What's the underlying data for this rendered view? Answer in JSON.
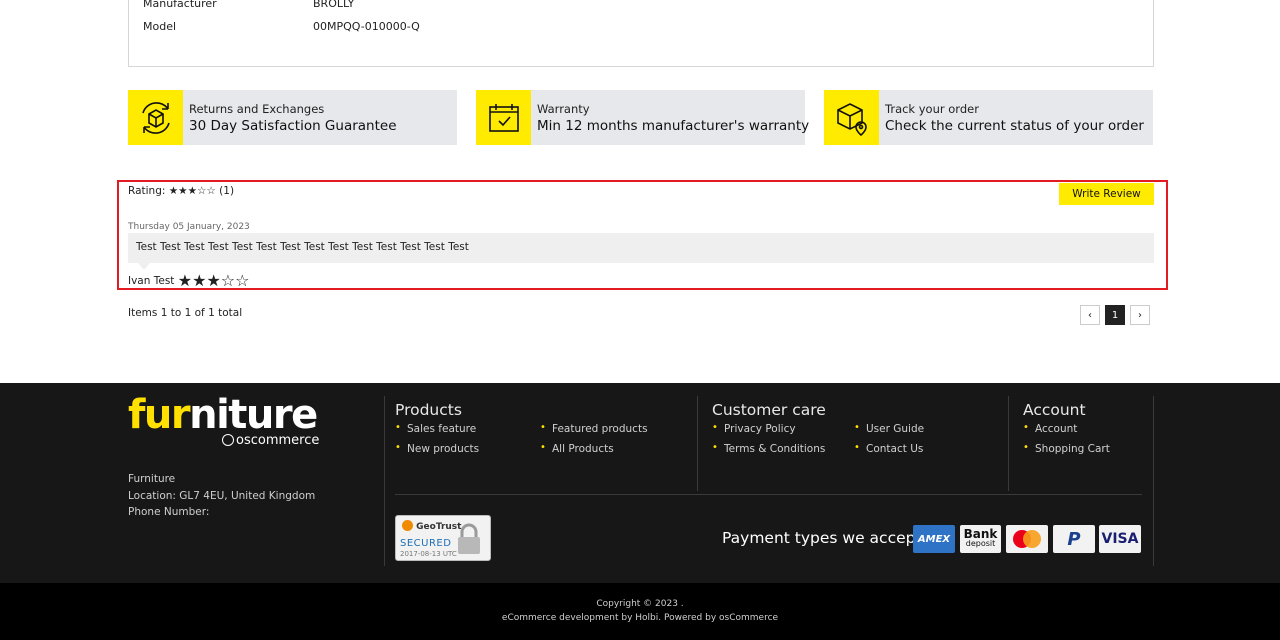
{
  "specs": [
    {
      "key": "Manufacturer",
      "value": "BROLLY"
    },
    {
      "key": "Model",
      "value": "00MPQQ-010000-Q"
    }
  ],
  "features": [
    {
      "icon": "returns-box-icon",
      "title": "Returns and Exchanges",
      "subtitle": "30 Day Satisfaction Guarantee"
    },
    {
      "icon": "calendar-check-icon",
      "title": "Warranty",
      "subtitle": "Min 12 months manufacturer's warranty"
    },
    {
      "icon": "track-order-box-icon",
      "title": "Track your order",
      "subtitle": "Check the current status of your order"
    }
  ],
  "reviews": {
    "rating_label": "Rating:",
    "rating_stars": "★★★☆☆",
    "rating_value": 3,
    "rating_count": "(1)",
    "write_review": "Write Review",
    "items": [
      {
        "date": "Thursday 05 January, 2023",
        "text": "Test Test Test Test Test Test Test Test Test Test Test Test Test Test",
        "author": "Ivan Test",
        "stars": "★★★☆☆",
        "rating": 3
      }
    ],
    "items_total": "Items 1 to 1 of 1 total",
    "pager": {
      "prev": "‹",
      "current": "1",
      "next": "›"
    }
  },
  "footer": {
    "logo": {
      "part1": "fur",
      "part2": "niture",
      "sub": "oscommerce"
    },
    "company": [
      "Furniture",
      "Location: GL7 4EU, United Kingdom",
      "Phone Number:"
    ],
    "products": {
      "title": "Products",
      "links": [
        "Sales feature",
        "New products",
        "Featured products",
        "All Products"
      ]
    },
    "customer_care": {
      "title": "Customer care",
      "links": [
        "Privacy Policy",
        "Terms & Conditions",
        "User Guide",
        "Contact Us"
      ]
    },
    "account": {
      "title": "Account",
      "links": [
        "Account",
        "Shopping Cart"
      ]
    },
    "geotrust": {
      "brand": "GeoTrust",
      "secured": "SECURED",
      "date": "2017-08-13 UTC"
    },
    "payment_label": "Payment types we accept",
    "payments": [
      "AMEX",
      "Bank deposit",
      "Mastercard",
      "PayPal",
      "VISA"
    ],
    "bank_line1": "Bank",
    "bank_line2": "deposit",
    "copyright": "Copyright © 2023 .",
    "credits": "eCommerce development by Holbi. Powered by osCommerce"
  },
  "colors": {
    "accent": "#ffeb00",
    "highlight_border": "#e31b23",
    "footer_bg": "#171717"
  }
}
